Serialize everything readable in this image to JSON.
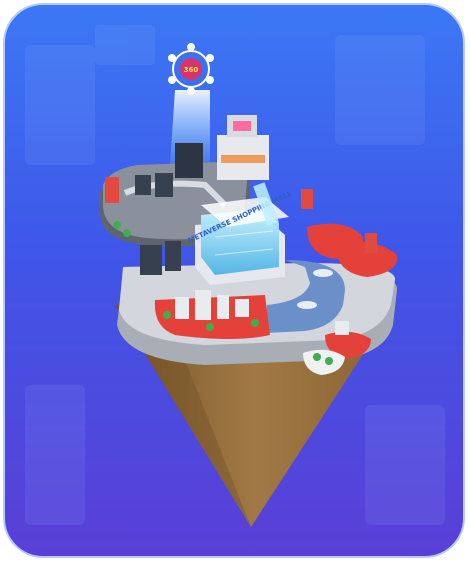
{
  "hero": {
    "sign_text": "METAVERSE SHOPPING MALL",
    "badge_text": "360",
    "colors": {
      "background_top": "#3b78f5",
      "background_bottom": "#5a3fd6",
      "island_dirt": "#a07945",
      "island_base": "#b9bcc4",
      "water": "#6a8fc9",
      "accent_red": "#e5413b",
      "glass": "#9be4ff"
    },
    "icons": [
      "network-globe-icon",
      "light-beam",
      "mall-building",
      "cloud-island"
    ]
  }
}
